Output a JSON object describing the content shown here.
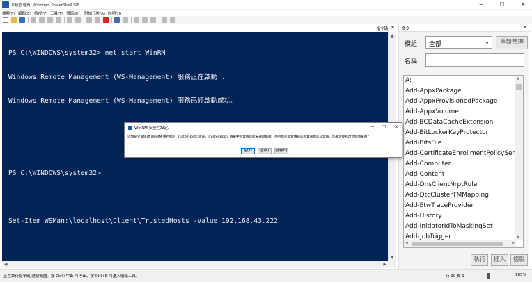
{
  "window": {
    "title": "系統管理員: Windows PowerShell ISE",
    "minimize": "─",
    "maximize": "☐",
    "close": "✕"
  },
  "menu": [
    "檔案(F)",
    "編輯(E)",
    "檢視(V)",
    "工具(T)",
    "偵錯(D)",
    "附加元件(A)",
    "說明(H)"
  ],
  "console_pane": {
    "header_label": "指令碼",
    "close": "✕",
    "lines": [
      "PS C:\\WINDOWS\\system32> net start WinRM",
      "Windows Remote Management (WS-Management) 服務正在啟動 .",
      "Windows Remote Management (WS-Management) 服務已經啟動成功。",
      "",
      "",
      "PS C:\\WINDOWS\\system32>",
      "",
      "Set-Item WSMan:\\localhost\\Client\\TrustedHosts -Value 192.168.43.222"
    ]
  },
  "dialog": {
    "title": "WinRM 安全性設定。",
    "message": "這個命令會修改 WinRM 用戶端的 TrustedHosts 清單。TrustedHosts 清單中的電腦可能未通過驗證。用戶端可能會傳送認證資訊給這些電腦。您確定要修改這個清單嗎?",
    "minimize": "─",
    "maximize": "☐",
    "close": "✕",
    "buttons": {
      "yes": "是(Y)",
      "no": "否(N)",
      "help": "說明(H)"
    }
  },
  "commands_panel": {
    "title": "命令",
    "close": "✕",
    "module_label": "模組:",
    "module_value": "全部",
    "refresh_button": "重新整理",
    "name_label": "名稱:",
    "name_value": "",
    "items": [
      "A:",
      "Add-AppxPackage",
      "Add-AppxProvisionedPackage",
      "Add-AppxVolume",
      "Add-BCDataCacheExtension",
      "Add-BitLockerKeyProtector",
      "Add-BitsFile",
      "Add-CertificateEnrollmentPolicyServer",
      "Add-Computer",
      "Add-Content",
      "Add-DnsClientNrptRule",
      "Add-DtcClusterTMMapping",
      "Add-EtwTraceProvider",
      "Add-History",
      "Add-InitiatorIdToMaskingSet",
      "Add-JobTrigger"
    ],
    "buttons": {
      "run": "執行",
      "insert": "插入",
      "copy": "複製"
    }
  },
  "statusbar": {
    "message": "正在執行指令碼/選取範圍。按 Ctrl+中斷 可停止。按 Ctrl+B 可進入偵錯工具。",
    "position": "行 10 欄 1",
    "zoom": "185%"
  },
  "colors": {
    "console_bg": "#012456",
    "console_text": "#eeedf0",
    "stop_button": "#d9231c"
  }
}
